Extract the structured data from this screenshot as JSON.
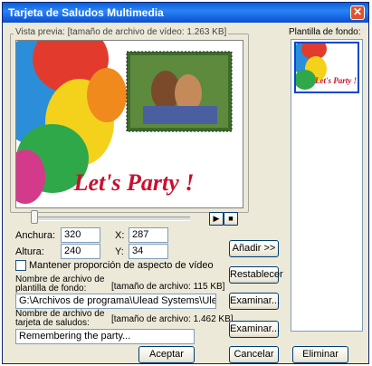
{
  "window": {
    "title": "Tarjeta de Saludos Multimedia"
  },
  "preview": {
    "label": "Vista previa: [tamaño de archivo de vídeo: 1.263 KB]",
    "caption": "Let's Party !"
  },
  "size": {
    "width_label": "Anchura:",
    "width_value": "320",
    "height_label": "Altura:",
    "height_value": "240"
  },
  "position": {
    "x_label": "X:",
    "x_value": "287",
    "y_label": "Y:",
    "y_value": "34"
  },
  "aspect": {
    "label": "Mantener proporción de aspecto de vídeo"
  },
  "background_file": {
    "label_line1": "Nombre de archivo de",
    "label_line2": "plantilla de fondo:",
    "size": "[tamaño de archivo: 115 KB]",
    "value": "G:\\Archivos de programa\\Ulead Systems\\Ulead"
  },
  "card_file": {
    "label_line1": "Nombre de archivo de",
    "label_line2": "tarjeta de saludos:",
    "size": "[tamaño de archivo: 1.462 KB]",
    "value": "Remembering the party..."
  },
  "buttons": {
    "add": "Añadir >>",
    "reset": "Restablecer",
    "browse1": "Examinar...",
    "browse2": "Examinar...",
    "ok": "Aceptar",
    "cancel": "Cancelar",
    "delete": "Eliminar"
  },
  "template": {
    "label": "Plantilla de fondo:",
    "thumb_caption": "Let's Party !"
  },
  "colors": {
    "title_blue": "#0a5fd8",
    "caption_red": "#c8102e",
    "face": "#ece9d8"
  }
}
